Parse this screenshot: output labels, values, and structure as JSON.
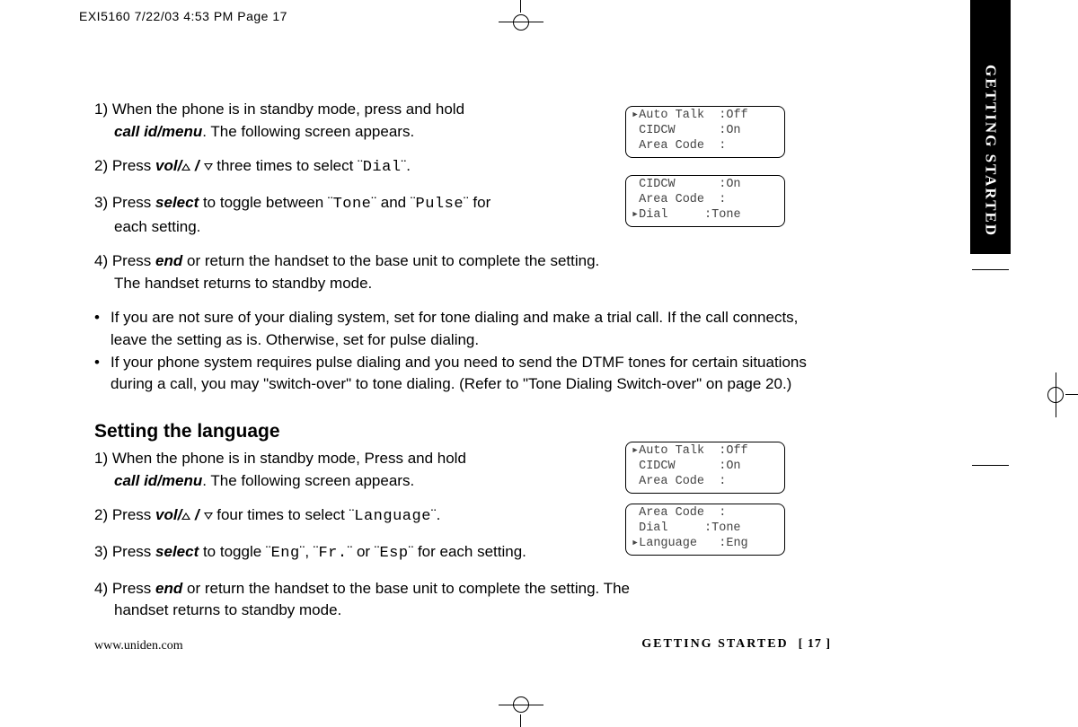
{
  "meta": {
    "header": "EXI5160  7/22/03 4:53 PM  Page 17"
  },
  "sidebar": {
    "label": "GETTING STARTED"
  },
  "steps_a": {
    "s1a": "1) When the phone is in standby mode, press and hold",
    "s1b": "call id/menu",
    "s1c": ". The following screen appears.",
    "s2a": "2) Press ",
    "s2b": "vol/",
    "s2c": " three times to select ¨",
    "s2d": "Dial",
    "s2e": "¨.",
    "s3a": "3) Press ",
    "s3b": "select",
    "s3c": " to toggle between ¨",
    "s3d": "Tone",
    "s3e": "¨ and ¨",
    "s3f": "Pulse",
    "s3g": "¨ for",
    "s3h": "each setting.",
    "s4a": "4) Press ",
    "s4b": "end",
    "s4c": " or return the handset to the base unit to complete the setting.",
    "s4d": "The handset returns to standby mode."
  },
  "bullets_a": {
    "b1": "If you are not sure of your dialing system, set for tone dialing and make a trial call. If the call connects, leave the setting as is. Otherwise, set for pulse dialing.",
    "b2a": "If your phone system requires pulse dialing and you need to send the DTMF tones for certain situations during a call, you may \"switch-over\" to tone dialing. (Refer to \"Tone Dialing Switch-over\" on page 20.)"
  },
  "section2": {
    "title": "Setting the language"
  },
  "steps_b": {
    "s1a": "1) When the phone is in standby mode, Press and hold",
    "s1b": "call id/menu",
    "s1c": ". The following screen appears.",
    "s2a": "2) Press ",
    "s2b": "vol/",
    "s2c": " four times to select ¨",
    "s2d": "Language",
    "s2e": "¨.",
    "s3a": "3) Press ",
    "s3b": "select",
    "s3c": " to toggle ¨",
    "s3d": "Eng",
    "s3e": "¨, ¨",
    "s3f": "Fr.",
    "s3g": "¨ or ¨",
    "s3h": "Esp",
    "s3i": "¨ for each setting.",
    "s4a": "4) Press ",
    "s4b": "end",
    "s4c": " or return the handset to the base unit to complete the setting. The",
    "s4d": "handset returns to standby mode."
  },
  "lcd": {
    "a": "▸Auto Talk  :Off\n CIDCW      :On\n Area Code  :",
    "b": " CIDCW      :On\n Area Code  :\n▸Dial     :Tone",
    "c": "▸Auto Talk  :Off\n CIDCW      :On\n Area Code  :",
    "d": " Area Code  :\n Dial     :Tone\n▸Language   :Eng"
  },
  "footer": {
    "url": "www.uniden.com",
    "section": "GETTING STARTED",
    "page": "[ 17 ]"
  }
}
